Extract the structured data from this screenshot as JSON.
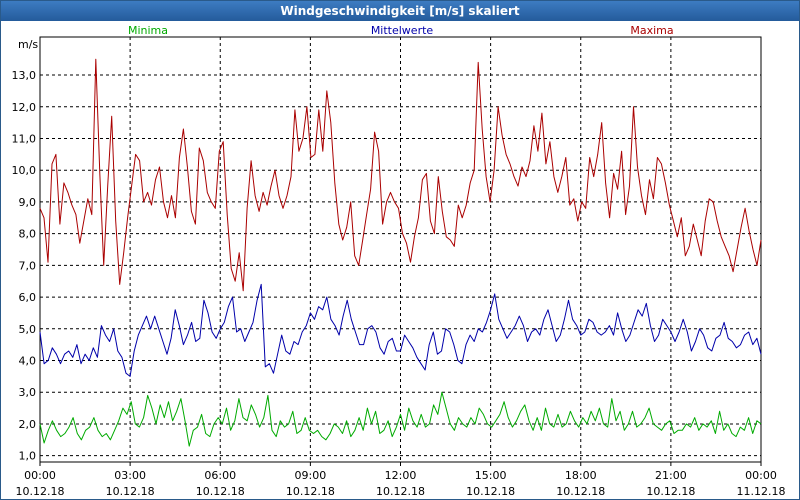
{
  "window": {
    "title": "Windgeschwindigkeit [m/s] skaliert"
  },
  "chart_data": {
    "type": "line",
    "title": "Windgeschwindigkeit [m/s] skaliert",
    "ylabel": "m/s",
    "ylim": [
      0.8,
      14.2
    ],
    "y_ticks": [
      "1,0",
      "2,0",
      "3,0",
      "4,0",
      "5,0",
      "6,0",
      "7,0",
      "8,0",
      "9,0",
      "10,0",
      "11,0",
      "12,0",
      "13,0"
    ],
    "x_ticks": [
      {
        "time": "00:00",
        "date": "10.12.18"
      },
      {
        "time": "03:00",
        "date": "10.12.18"
      },
      {
        "time": "06:00",
        "date": "10.12.18"
      },
      {
        "time": "09:00",
        "date": "10.12.18"
      },
      {
        "time": "12:00",
        "date": "10.12.18"
      },
      {
        "time": "15:00",
        "date": "10.12.18"
      },
      {
        "time": "18:00",
        "date": "10.12.18"
      },
      {
        "time": "21:00",
        "date": "10.12.18"
      },
      {
        "time": "00:00",
        "date": "11.12.18"
      }
    ],
    "xlim_hours": [
      0,
      24
    ],
    "grid": true,
    "legend_position": "top",
    "series": [
      {
        "name": "Minima",
        "color": "#00aa00",
        "values": [
          2.0,
          1.4,
          1.8,
          2.1,
          1.8,
          1.6,
          1.7,
          1.9,
          2.2,
          1.7,
          1.5,
          1.8,
          1.9,
          2.2,
          1.8,
          1.6,
          1.7,
          1.5,
          1.8,
          2.1,
          2.5,
          2.3,
          2.7,
          2.0,
          1.9,
          2.2,
          2.9,
          2.5,
          2.0,
          2.6,
          2.2,
          2.7,
          2.1,
          2.4,
          2.8,
          2.1,
          1.3,
          1.8,
          1.9,
          2.3,
          1.7,
          1.6,
          2.0,
          2.2,
          2.0,
          2.5,
          1.8,
          2.1,
          2.8,
          2.2,
          2.1,
          2.6,
          2.3,
          1.9,
          2.2,
          2.9,
          1.8,
          1.6,
          2.1,
          1.9,
          2.0,
          2.4,
          1.7,
          1.8,
          2.2,
          1.8,
          1.7,
          1.8,
          1.6,
          1.5,
          1.7,
          2.0,
          1.9,
          1.7,
          2.1,
          1.6,
          1.8,
          2.2,
          1.8,
          2.5,
          2.0,
          2.4,
          1.7,
          1.8,
          2.1,
          1.6,
          1.9,
          2.3,
          1.8,
          2.5,
          2.1,
          1.9,
          2.3,
          1.9,
          2.0,
          2.6,
          2.3,
          3.0,
          2.5,
          2.0,
          1.8,
          2.2,
          2.0,
          1.9,
          2.2,
          2.0,
          2.5,
          2.3,
          2.0,
          1.9,
          2.1,
          2.3,
          2.7,
          2.2,
          1.9,
          2.1,
          2.4,
          2.6,
          2.1,
          1.8,
          2.2,
          1.8,
          2.5,
          2.0,
          1.9,
          2.3,
          1.9,
          2.0,
          2.4,
          2.1,
          1.9,
          2.2,
          2.0,
          2.4,
          2.1,
          2.5,
          2.0,
          1.9,
          2.8,
          2.1,
          2.4,
          1.8,
          2.0,
          2.4,
          1.9,
          2.0,
          2.2,
          2.5,
          2.0,
          1.9,
          1.8,
          2.0,
          2.1,
          1.7,
          1.8,
          1.8,
          2.0,
          1.9,
          2.2,
          1.8,
          2.0,
          1.9,
          2.1,
          1.7,
          2.4,
          1.8,
          2.0,
          1.7,
          1.6,
          1.9,
          1.8,
          2.2,
          1.7,
          2.1,
          2.0
        ]
      },
      {
        "name": "Mittelwerte",
        "color": "#0000aa",
        "values": [
          4.9,
          3.9,
          4.0,
          4.4,
          4.2,
          3.9,
          4.2,
          4.3,
          4.1,
          4.5,
          3.9,
          4.2,
          4.0,
          4.4,
          4.1,
          5.1,
          4.8,
          4.6,
          5.0,
          4.3,
          4.1,
          3.6,
          3.5,
          4.3,
          4.8,
          5.1,
          5.4,
          5.0,
          5.4,
          5.0,
          4.6,
          4.2,
          4.7,
          5.6,
          5.1,
          4.5,
          4.8,
          5.2,
          4.6,
          4.7,
          5.9,
          5.5,
          4.9,
          4.7,
          5.0,
          5.2,
          5.7,
          6.0,
          4.9,
          5.0,
          4.6,
          4.9,
          5.2,
          5.9,
          6.4,
          3.8,
          3.9,
          3.6,
          4.2,
          4.8,
          4.3,
          4.2,
          4.6,
          4.5,
          4.9,
          5.1,
          5.5,
          5.3,
          5.7,
          5.6,
          6.0,
          5.3,
          5.1,
          4.8,
          5.4,
          5.9,
          5.3,
          4.9,
          4.5,
          4.5,
          5.0,
          5.1,
          4.9,
          4.4,
          4.2,
          4.6,
          4.7,
          4.3,
          4.3,
          4.8,
          4.6,
          4.4,
          4.1,
          3.9,
          3.7,
          4.5,
          4.9,
          4.2,
          4.3,
          5.0,
          4.9,
          4.5,
          4.0,
          3.9,
          4.5,
          4.8,
          4.6,
          5.0,
          4.9,
          5.2,
          5.6,
          6.1,
          5.3,
          5.0,
          4.7,
          4.9,
          5.1,
          5.4,
          5.1,
          4.6,
          4.9,
          5.0,
          4.8,
          5.3,
          5.6,
          5.1,
          4.6,
          4.8,
          5.3,
          5.9,
          5.3,
          5.1,
          4.8,
          4.9,
          5.3,
          5.2,
          4.9,
          4.8,
          4.9,
          5.1,
          4.8,
          5.5,
          5.0,
          4.6,
          4.8,
          5.2,
          5.6,
          5.4,
          5.8,
          5.1,
          4.6,
          4.8,
          5.3,
          5.1,
          4.9,
          4.6,
          4.9,
          5.3,
          4.9,
          4.3,
          4.6,
          5.0,
          4.8,
          4.4,
          4.3,
          4.7,
          4.8,
          5.2,
          4.7,
          4.6,
          4.4,
          4.5,
          4.8,
          4.9,
          4.5,
          4.7,
          4.2
        ]
      },
      {
        "name": "Maxima",
        "color": "#aa0000",
        "values": [
          8.8,
          8.5,
          7.1,
          10.2,
          10.5,
          8.3,
          9.6,
          9.3,
          8.9,
          8.6,
          7.7,
          8.4,
          9.1,
          8.6,
          13.5,
          9.9,
          7.0,
          9.5,
          11.7,
          8.4,
          6.4,
          7.4,
          8.5,
          9.5,
          10.5,
          10.3,
          9.0,
          9.3,
          8.9,
          9.7,
          10.1,
          9.0,
          8.5,
          9.2,
          8.5,
          10.4,
          11.3,
          10.1,
          8.7,
          8.3,
          10.7,
          10.3,
          9.3,
          9.0,
          8.8,
          10.6,
          10.9,
          8.6,
          6.9,
          6.5,
          7.4,
          6.2,
          8.8,
          10.3,
          9.2,
          8.7,
          9.3,
          8.9,
          9.5,
          10.0,
          9.2,
          8.8,
          9.2,
          9.8,
          11.9,
          10.6,
          11.0,
          12.0,
          10.4,
          10.5,
          11.9,
          10.6,
          12.5,
          11.5,
          9.6,
          8.3,
          7.8,
          8.2,
          9.0,
          7.3,
          7.0,
          7.8,
          8.6,
          9.4,
          11.2,
          10.6,
          8.3,
          9.0,
          9.3,
          9.0,
          8.8,
          8.0,
          7.7,
          7.1,
          7.9,
          8.5,
          9.7,
          9.9,
          8.4,
          8.0,
          9.8,
          8.7,
          7.9,
          7.8,
          7.6,
          8.9,
          8.5,
          8.9,
          9.6,
          10.0,
          13.4,
          11.3,
          9.8,
          9.0,
          10.0,
          12.0,
          11.1,
          10.5,
          10.2,
          9.8,
          9.5,
          10.1,
          9.8,
          10.3,
          11.4,
          10.6,
          11.8,
          10.2,
          10.9,
          9.8,
          9.3,
          9.8,
          10.4,
          8.9,
          9.1,
          8.4,
          9.0,
          8.8,
          10.4,
          9.8,
          10.5,
          11.5,
          9.6,
          8.5,
          9.9,
          9.4,
          10.6,
          8.6,
          9.5,
          12.0,
          10.1,
          9.2,
          8.6,
          9.7,
          9.1,
          10.4,
          10.2,
          9.6,
          8.9,
          8.4,
          7.9,
          8.5,
          7.3,
          7.6,
          8.3,
          7.8,
          7.3,
          8.4,
          9.1,
          9.0,
          8.4,
          7.9,
          7.6,
          7.3,
          6.8,
          7.5,
          8.2,
          8.8,
          8.1,
          7.5,
          7.0,
          7.8
        ]
      }
    ]
  }
}
